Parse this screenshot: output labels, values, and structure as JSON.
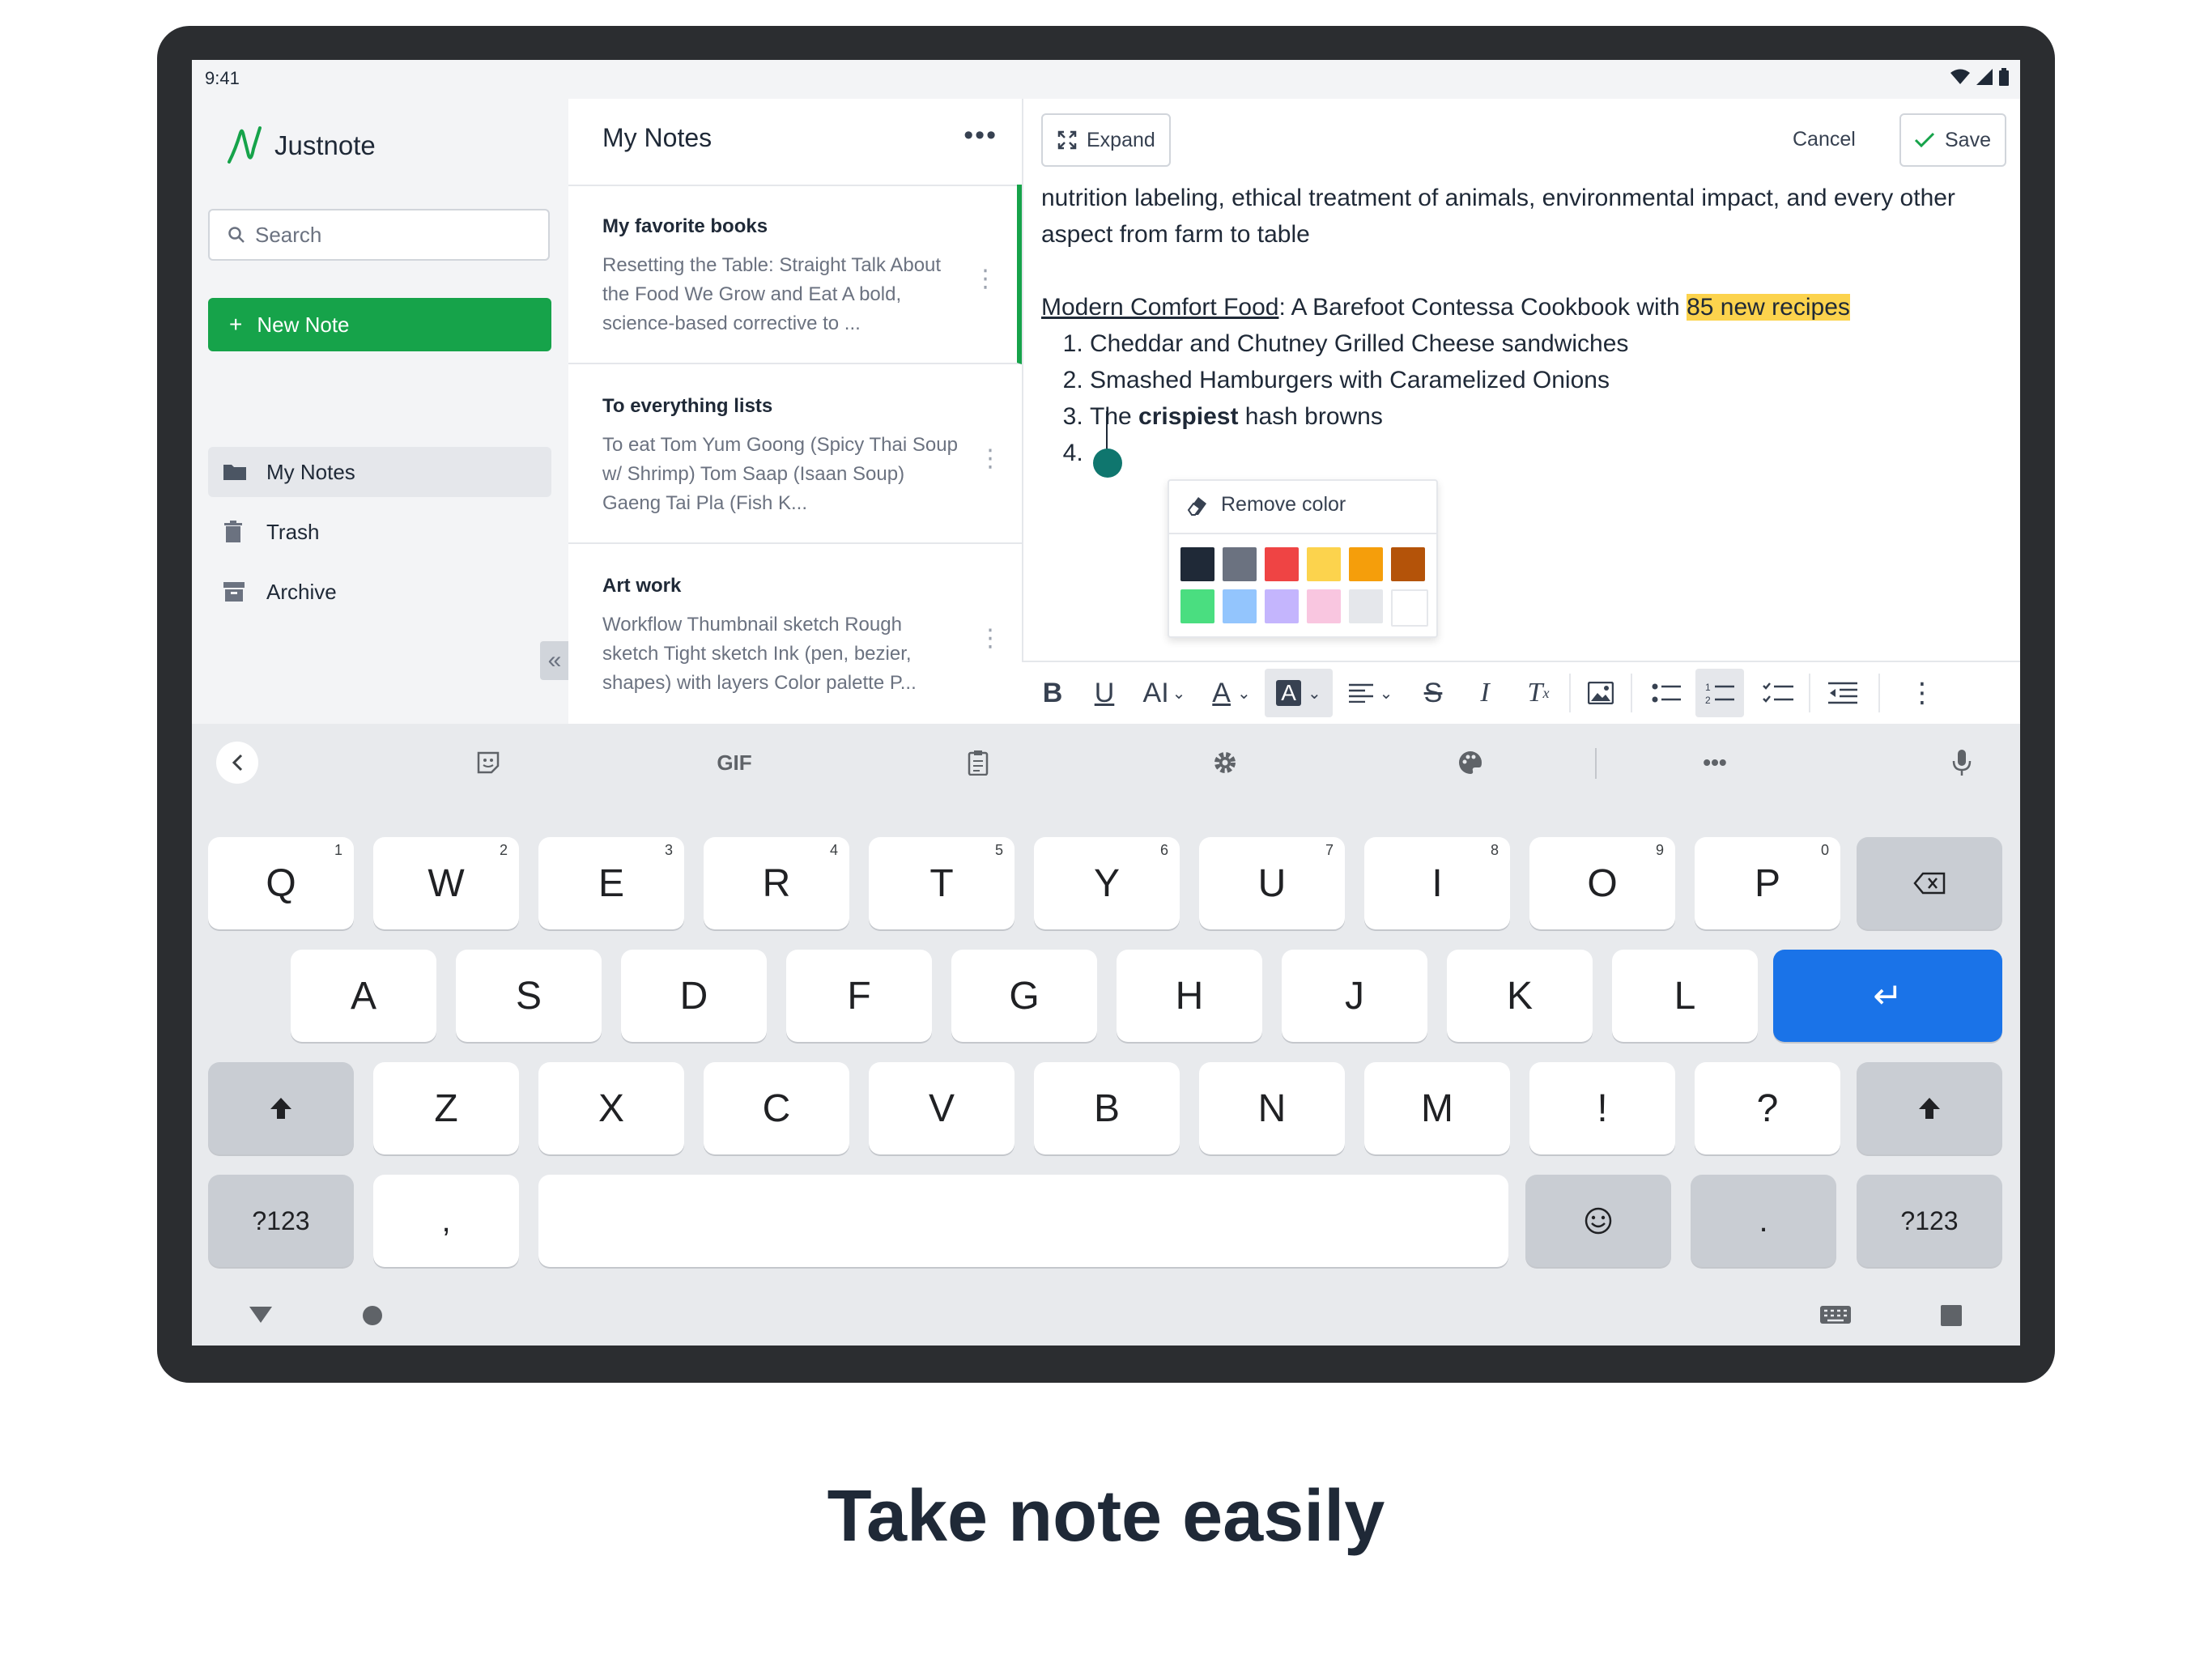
{
  "status": {
    "time": "9:41"
  },
  "app": {
    "name": "Justnote"
  },
  "sidebar": {
    "search_placeholder": "Search",
    "new_note_label": "New Note",
    "items": [
      {
        "label": "My Notes",
        "icon": "folder-icon"
      },
      {
        "label": "Trash",
        "icon": "trash-icon"
      },
      {
        "label": "Archive",
        "icon": "archive-icon"
      }
    ],
    "collapse_glyph": "«"
  },
  "notes": {
    "title": "My Notes",
    "more_glyph": "•••",
    "items": [
      {
        "title": "My favorite books",
        "preview": "Resetting the Table: Straight Talk About the Food We Grow and Eat A bold, science-based corrective to ..."
      },
      {
        "title": "To everything lists",
        "preview": "To eat Tom Yum Goong (Spicy Thai Soup w/ Shrimp) Tom Saap (Isaan Soup) Gaeng Tai Pla (Fish K..."
      },
      {
        "title": "Art work",
        "preview": "Workflow Thumbnail sketch Rough sketch Tight sketch Ink (pen, bezier, shapes) with layers Color palette P..."
      }
    ]
  },
  "editor": {
    "expand_label": "Expand",
    "cancel_label": "Cancel",
    "save_label": "Save",
    "para1": "nutrition labeling, ethical treatment of animals, environmental impact, and every other aspect from farm to table",
    "link_text": "Modern Comfort Food",
    "line_mid": ": A Barefoot Contessa Cookbook with ",
    "highlight_text": "85 new recipes",
    "list": {
      "item1": "Cheddar and Chutney Grilled Cheese sandwiches",
      "item2": "Smashed Hamburgers with Caramelized Onions",
      "item3_pre": "The ",
      "item3_bold": "crispiest",
      "item3_post": " hash browns"
    },
    "color_popup": {
      "remove_label": "Remove color",
      "swatches": [
        "#1f2937",
        "#6b7280",
        "#ef4444",
        "#fcd34d",
        "#f59e0b",
        "#b45309",
        "#4ade80",
        "#93c5fd",
        "#c4b5fd",
        "#f9c6e0",
        "#e5e7eb",
        "#ffffff"
      ]
    },
    "toolbar": {
      "bold": "B",
      "underline": "U",
      "font_size": "AI",
      "text_color": "A",
      "bg_color": "A",
      "strike": "S",
      "italic": "I",
      "clear": "T"
    }
  },
  "keyboard": {
    "toolbar": {
      "gif_label": "GIF",
      "more_glyph": "•••"
    },
    "row1": [
      {
        "k": "Q",
        "h": "1"
      },
      {
        "k": "W",
        "h": "2"
      },
      {
        "k": "E",
        "h": "3"
      },
      {
        "k": "R",
        "h": "4"
      },
      {
        "k": "T",
        "h": "5"
      },
      {
        "k": "Y",
        "h": "6"
      },
      {
        "k": "U",
        "h": "7"
      },
      {
        "k": "I",
        "h": "8"
      },
      {
        "k": "O",
        "h": "9"
      },
      {
        "k": "P",
        "h": "0"
      }
    ],
    "row2": [
      "A",
      "S",
      "D",
      "F",
      "G",
      "H",
      "J",
      "K",
      "L"
    ],
    "row3": [
      "Z",
      "X",
      "C",
      "V",
      "B",
      "N",
      "M",
      "!",
      "?"
    ],
    "symbols_label": "?123",
    "comma": ",",
    "period": ".",
    "enter_glyph": "↵"
  },
  "caption": "Take note easily",
  "colors": {
    "brand_green": "#16a34a",
    "enter_blue": "#1a73e8",
    "highlight": "#fcd34d",
    "cursor_teal": "#0f766e"
  }
}
